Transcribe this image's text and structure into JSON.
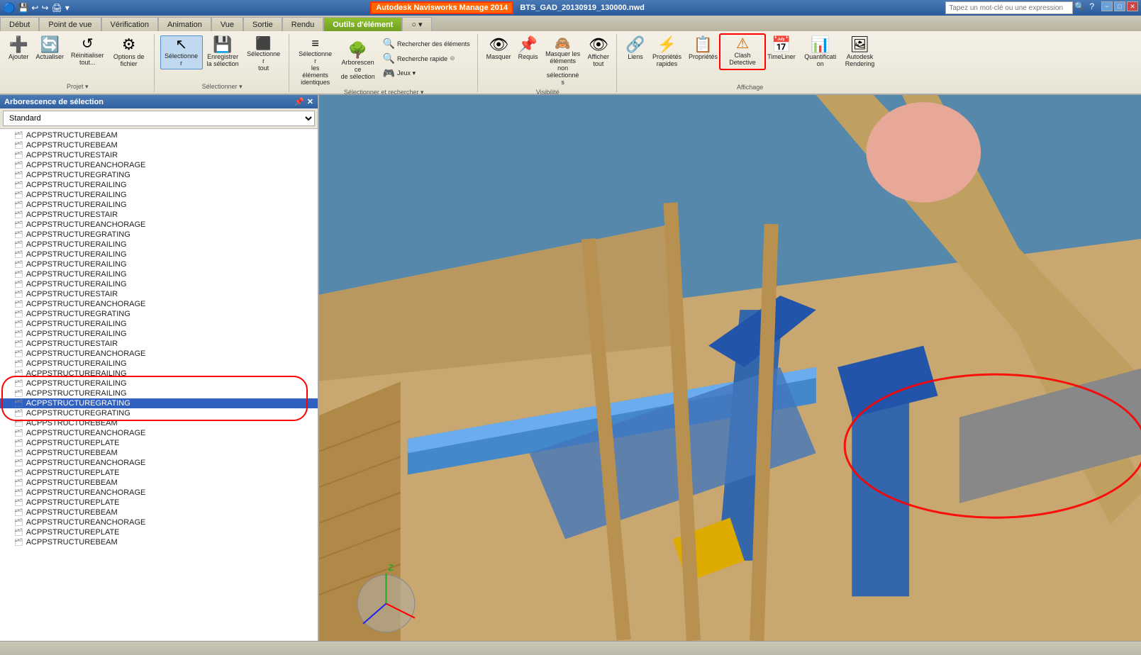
{
  "titleBar": {
    "appTitle": "Autodesk Navisworks Manage 2014",
    "fileName": "BTS_GAD_20130919_130000.nwd",
    "searchPlaceholder": "Tapez un mot-clé ou une expression",
    "winButtons": [
      "−",
      "□",
      "✕"
    ]
  },
  "ribbon": {
    "tabs": [
      {
        "label": "Début",
        "active": false
      },
      {
        "label": "Point de vue",
        "active": false
      },
      {
        "label": "Vérification",
        "active": false
      },
      {
        "label": "Animation",
        "active": false
      },
      {
        "label": "Vue",
        "active": false
      },
      {
        "label": "Sortie",
        "active": false
      },
      {
        "label": "Rendu",
        "active": false
      },
      {
        "label": "Outils d'élément",
        "active": true,
        "green": true
      },
      {
        "label": "○ ▾",
        "active": false
      }
    ],
    "groups": [
      {
        "name": "Projet",
        "items": [
          {
            "label": "Ajouter",
            "icon": "add",
            "type": "large"
          },
          {
            "label": "Actualiser",
            "icon": "refresh",
            "type": "large"
          },
          {
            "label": "Réinitialiser tout...",
            "icon": "reset",
            "type": "large"
          },
          {
            "label": "Options de fichier",
            "icon": "options",
            "type": "large"
          }
        ]
      },
      {
        "name": "Sélectionner",
        "items": [
          {
            "label": "Sélectionner",
            "icon": "select",
            "type": "large",
            "active": true
          },
          {
            "label": "Enregistrer la sélection",
            "icon": "save",
            "type": "large"
          },
          {
            "label": "Sélectionner tout",
            "icon": "select-all",
            "type": "large"
          }
        ]
      },
      {
        "name": "Sélectionner et rechercher",
        "items": [
          {
            "label": "Sélectionner les éléments identiques",
            "icon": "select-same",
            "type": "large"
          },
          {
            "label": "Arborescence de sélection",
            "icon": "tree",
            "type": "large"
          },
          {
            "label": "Rechercher des éléments",
            "icon": "search-el",
            "type": "small-right"
          },
          {
            "label": "Recherche rapide",
            "icon": "search-el",
            "type": "small-right"
          },
          {
            "label": "Jeux ▾",
            "icon": "game",
            "type": "small-right"
          }
        ]
      },
      {
        "name": "Visibilité",
        "items": [
          {
            "label": "Masquer",
            "icon": "hide",
            "type": "large"
          },
          {
            "label": "Requis",
            "icon": "required",
            "type": "large"
          },
          {
            "label": "Masquer les éléments non sélectionnés",
            "icon": "hide-unsel",
            "type": "large"
          },
          {
            "label": "Afficher tout",
            "icon": "show-all",
            "type": "large"
          }
        ]
      },
      {
        "name": "Affichage",
        "items": [
          {
            "label": "Liens",
            "icon": "link",
            "type": "large"
          },
          {
            "label": "Propriétés rapides",
            "icon": "prop-quick",
            "type": "large"
          },
          {
            "label": "Propriétés",
            "icon": "prop",
            "type": "large"
          },
          {
            "label": "Clash Detective",
            "icon": "clash",
            "type": "large"
          },
          {
            "label": "TimeLiner",
            "icon": "timeline",
            "type": "large"
          },
          {
            "label": "Quantification",
            "icon": "quantif",
            "type": "large"
          },
          {
            "label": "Autodesk Rendering",
            "icon": "rendering",
            "type": "large"
          }
        ]
      }
    ]
  },
  "sidebar": {
    "title": "Arborescence de sélection",
    "dropdown": "Standard",
    "treeItems": [
      {
        "label": "ACPPSTRUCTUREBEAM",
        "selected": false,
        "circled": false
      },
      {
        "label": "ACPPSTRUCTUREBEAM",
        "selected": false,
        "circled": false
      },
      {
        "label": "ACPPSTRUCTURESTAIR",
        "selected": false,
        "circled": false
      },
      {
        "label": "ACPPSTRUCTUREANCHORAGE",
        "selected": false,
        "circled": false
      },
      {
        "label": "ACPPSTRUCTUREGRATING",
        "selected": false,
        "circled": false
      },
      {
        "label": "ACPPSTRUCTURERAILING",
        "selected": false,
        "circled": false
      },
      {
        "label": "ACPPSTRUCTURERAILING",
        "selected": false,
        "circled": false
      },
      {
        "label": "ACPPSTRUCTURERAILING",
        "selected": false,
        "circled": false
      },
      {
        "label": "ACPPSTRUCTURESTAIR",
        "selected": false,
        "circled": false
      },
      {
        "label": "ACPPSTRUCTUREANCHORAGE",
        "selected": false,
        "circled": false
      },
      {
        "label": "ACPPSTRUCTUREGRATING",
        "selected": false,
        "circled": false
      },
      {
        "label": "ACPPSTRUCTURERAILING",
        "selected": false,
        "circled": false
      },
      {
        "label": "ACPPSTRUCTURERAILING",
        "selected": false,
        "circled": false
      },
      {
        "label": "ACPPSTRUCTURERAILING",
        "selected": false,
        "circled": false
      },
      {
        "label": "ACPPSTRUCTURERAILING",
        "selected": false,
        "circled": false
      },
      {
        "label": "ACPPSTRUCTURERAILING",
        "selected": false,
        "circled": false
      },
      {
        "label": "ACPPSTRUCTURESTAIR",
        "selected": false,
        "circled": false
      },
      {
        "label": "ACPPSTRUCTUREANCHORAGE",
        "selected": false,
        "circled": false
      },
      {
        "label": "ACPPSTRUCTUREGRATING",
        "selected": false,
        "circled": false
      },
      {
        "label": "ACPPSTRUCTURERAILING",
        "selected": false,
        "circled": false
      },
      {
        "label": "ACPPSTRUCTURERAILING",
        "selected": false,
        "circled": false
      },
      {
        "label": "ACPPSTRUCTURESTAIR",
        "selected": false,
        "circled": false
      },
      {
        "label": "ACPPSTRUCTUREANCHORAGE",
        "selected": false,
        "circled": false
      },
      {
        "label": "ACPPSTRUCTURERAILING",
        "selected": false,
        "circled": false
      },
      {
        "label": "ACPPSTRUCTURERAILING",
        "selected": false,
        "circled": false
      },
      {
        "label": "ACPPSTRUCTURERAILING",
        "selected": false,
        "circled": true,
        "redBorder": true
      },
      {
        "label": "ACPPSTRUCTURERAILING",
        "selected": false,
        "circled": true,
        "redBorder": true
      },
      {
        "label": "ACPPSTRUCTUREGRATING",
        "selected": true,
        "circled": true,
        "redBorder": true
      },
      {
        "label": "ACPPSTRUCTUREGRATING",
        "selected": false,
        "circled": true,
        "redBorder": true
      },
      {
        "label": "ACPPSTRUCTUREBEAM",
        "selected": false,
        "circled": false
      },
      {
        "label": "ACPPSTRUCTUREANCHORAGE",
        "selected": false,
        "circled": false
      },
      {
        "label": "ACPPSTRUCTUREPLATE",
        "selected": false,
        "circled": false
      },
      {
        "label": "ACPPSTRUCTUREBEAM",
        "selected": false,
        "circled": false
      },
      {
        "label": "ACPPSTRUCTUREANCHORAGE",
        "selected": false,
        "circled": false
      },
      {
        "label": "ACPPSTRUCTUREPLATE",
        "selected": false,
        "circled": false
      },
      {
        "label": "ACPPSTRUCTUREBEAM",
        "selected": false,
        "circled": false
      },
      {
        "label": "ACPPSTRUCTUREANCHORAGE",
        "selected": false,
        "circled": false
      },
      {
        "label": "ACPPSTRUCTUREPLATE",
        "selected": false,
        "circled": false
      },
      {
        "label": "ACPPSTRUCTUREBEAM",
        "selected": false,
        "circled": false
      },
      {
        "label": "ACPPSTRUCTUREANCHORAGE",
        "selected": false,
        "circled": false
      },
      {
        "label": "ACPPSTRUCTUREPLATE",
        "selected": false,
        "circled": false
      },
      {
        "label": "ACPPSTRUCTUREBEAM",
        "selected": false,
        "circled": false
      }
    ]
  },
  "viewport": {
    "backgroundColor": "#7a9ab0",
    "compassLabel": "Z"
  },
  "statusBar": {
    "text": ""
  },
  "clashDetective": {
    "label": "Clash Detective"
  }
}
